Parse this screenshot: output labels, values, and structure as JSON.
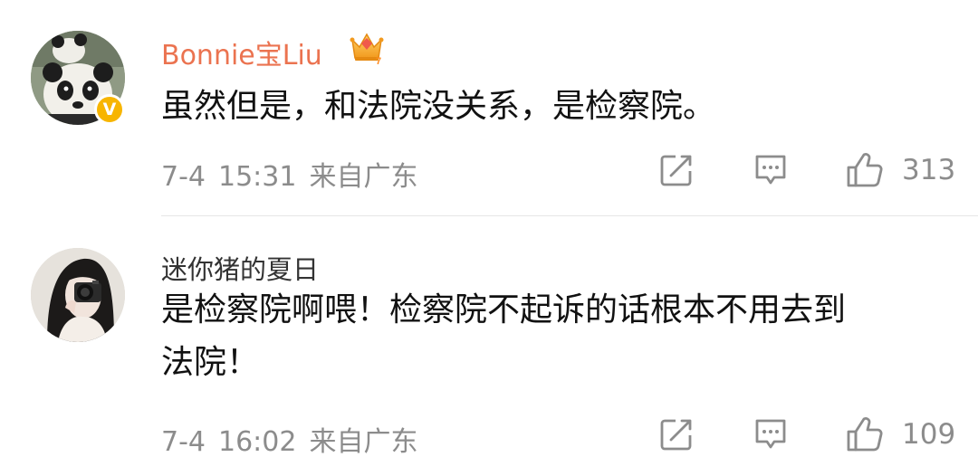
{
  "comments": [
    {
      "username": "Bonnie宝Liu",
      "verified_badge": "V",
      "badge_icon": "crown-icon",
      "avatar": "panda-avatar",
      "content": [
        "虽然但是，和法院没关系，是检察院。"
      ],
      "date": "7-4",
      "time": "15:31",
      "source": "来自广东",
      "like_count": "313"
    },
    {
      "username": "迷你猪的夏日",
      "avatar": "camera-girl-avatar",
      "content": [
        "是检察院啊喂！检察院不起诉的话根本不用去到",
        "法院！"
      ],
      "date": "7-4",
      "time": "16:02",
      "source": "来自广东",
      "like_count": "109"
    }
  ],
  "colors": {
    "username_vip": "#eb7350",
    "meta_text": "#8c8c8c",
    "verify_badge": "#f7b500",
    "divider": "#e6e6e6"
  },
  "actions": [
    "repost-icon",
    "comment-icon",
    "like-icon"
  ]
}
